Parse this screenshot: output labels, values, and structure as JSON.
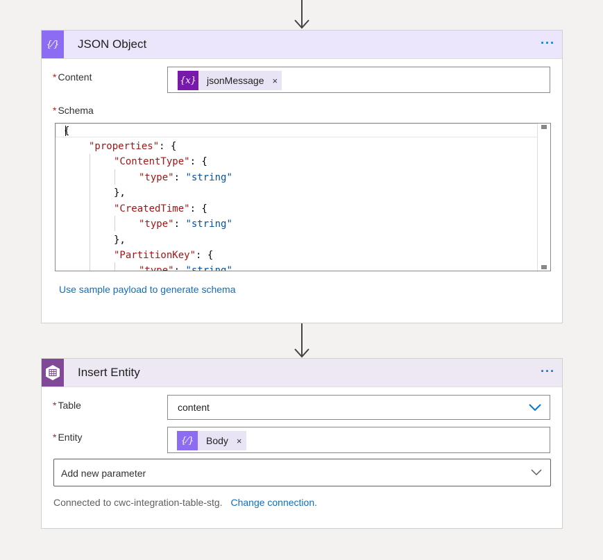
{
  "json_card": {
    "title": "JSON Object",
    "icon": "braces-icon",
    "header_bg": "#ebe6fb",
    "icon_bg": "#8c6cf2",
    "more_label": "···",
    "content_label": "Content",
    "content_token": {
      "label": "jsonMessage",
      "icon": "variable-icon",
      "icon_text": "{x}",
      "close": "×"
    },
    "schema_label": "Schema",
    "schema_lines": [
      [
        "{"
      ],
      [
        "\"properties\"",
        ": {"
      ],
      [
        "\"ContentType\"",
        ": {"
      ],
      [
        "\"type\"",
        ": ",
        "\"string\""
      ],
      [
        "},"
      ],
      [
        "\"CreatedTime\"",
        ": {"
      ],
      [
        "\"type\"",
        ": ",
        "\"string\""
      ],
      [
        "},"
      ],
      [
        "\"PartitionKey\"",
        ": {"
      ],
      [
        "\"type\"",
        ": ",
        "\"string\""
      ]
    ],
    "sample_link": "Use sample payload to generate schema"
  },
  "entity_card": {
    "title": "Insert Entity",
    "icon": "table-storage-icon",
    "header_bg": "#ede8f3",
    "icon_bg": "#804998",
    "more_label": "···",
    "table_label": "Table",
    "table_value": "content",
    "entity_label": "Entity",
    "entity_token": {
      "label": "Body",
      "icon": "braces-icon",
      "icon_text": "{⁄}",
      "close": "×"
    },
    "add_param_label": "Add new parameter",
    "connection_text": "Connected to cwc-integration-table-stg.",
    "change_connection": "Change connection."
  },
  "required_mark": "*"
}
